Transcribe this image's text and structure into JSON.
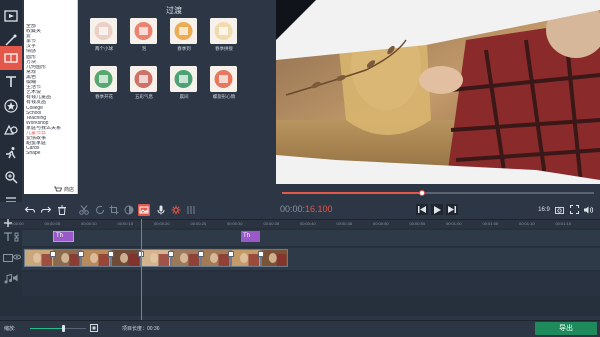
{
  "left_tools": [
    {
      "name": "import-tool"
    },
    {
      "name": "filters-tool"
    },
    {
      "name": "transitions-tool"
    },
    {
      "name": "titles-tool"
    },
    {
      "name": "stickers-tool"
    },
    {
      "name": "callouts-tool"
    },
    {
      "name": "motion-tool"
    },
    {
      "name": "zoom-tool"
    },
    {
      "name": "more-tool"
    }
  ],
  "categories": [
    "全部",
    "收藏夹",
    "爱",
    "季节",
    "汉字",
    "情感",
    "圆形",
    "方块",
    "几何图形",
    "常规",
    "黑色",
    "模糊",
    "生活节",
    "艺术设",
    "有钱儿童品",
    "有钱发品",
    "College",
    "School",
    "Teaching",
    "Workshop",
    "家庭与我么关系",
    "儿童节日",
    "爱情故事",
    "甜蜜家庭",
    "Cards",
    "Shape"
  ],
  "categories_selected": 21,
  "store_label": "商店",
  "transitions": {
    "title": "过渡",
    "items": [
      {
        "label": "两个小球",
        "accent": "#eac9c0"
      },
      {
        "label": "泡",
        "accent": "#e76f5a"
      },
      {
        "label": "春季到",
        "accent": "#e8a13c"
      },
      {
        "label": "春季拼接",
        "accent": "#f1d6a6"
      },
      {
        "label": "春季开花",
        "accent": "#3b9a5e"
      },
      {
        "label": "五彩气息",
        "accent": "#c65a52"
      },
      {
        "label": "晨间",
        "accent": "#2f9460"
      },
      {
        "label": "螺旋形心情",
        "accent": "#e06448"
      }
    ]
  },
  "preview": {
    "progress": 0.45
  },
  "timecode": {
    "main": "00:00:",
    "highlight": "16.100"
  },
  "transport": {
    "aspect": "16:9"
  },
  "ruler": [
    "00:00:00",
    "00:00:05",
    "00:00:10",
    "00:00:15",
    "00:00:20",
    "00:00:25",
    "00:00:30",
    "00:00:35",
    "00:00:40",
    "00:00:45",
    "00:00:50",
    "00:00:55",
    "00:01:00",
    "00:01:05",
    "00:01:10",
    "00:01:15"
  ],
  "title_clips": [
    {
      "label": "Th"
    },
    {
      "label": "Th"
    }
  ],
  "bottom": {
    "zoom_label": "缩放:",
    "zoom_value": 0.6,
    "project_length_label": "项目长度：",
    "project_length_value": "00:36",
    "export_label": "导出"
  },
  "colors": {
    "accent": "#e4574b",
    "export": "#1f8a5c",
    "timeline_clip_title": "#9a59c9"
  }
}
